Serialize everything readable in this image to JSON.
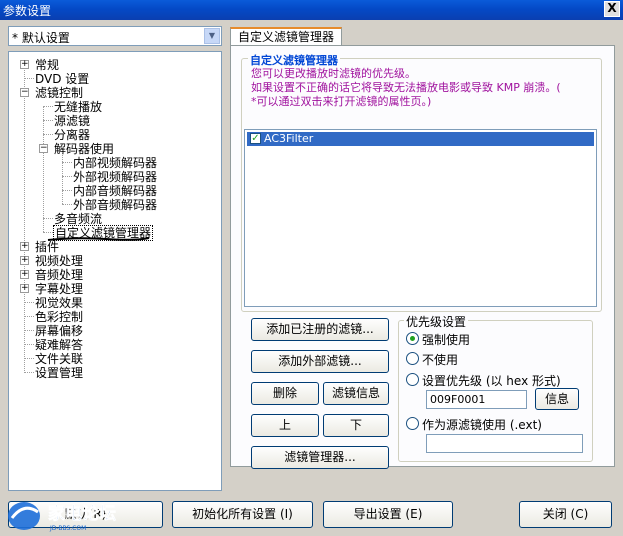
{
  "window": {
    "title": "参数设置",
    "close_label": "X"
  },
  "profile_select": {
    "value": "* 默认设置"
  },
  "tree": {
    "items": [
      {
        "label": "常规",
        "expander": "+"
      },
      {
        "label": "DVD 设置"
      },
      {
        "label": "滤镜控制",
        "expander": "−"
      },
      {
        "label": "无缝播放"
      },
      {
        "label": "源滤镜"
      },
      {
        "label": "分离器"
      },
      {
        "label": "解码器使用",
        "expander": "−"
      },
      {
        "label": "内部视频解码器"
      },
      {
        "label": "外部视频解码器"
      },
      {
        "label": "内部音频解码器"
      },
      {
        "label": "外部音频解码器"
      },
      {
        "label": "多音频流"
      },
      {
        "label": "自定义滤镜管理器",
        "selected": true
      },
      {
        "label": "插件",
        "expander": "+"
      },
      {
        "label": "视频处理",
        "expander": "+"
      },
      {
        "label": "音频处理",
        "expander": "+"
      },
      {
        "label": "字幕处理",
        "expander": "+"
      },
      {
        "label": "视觉效果"
      },
      {
        "label": "色彩控制"
      },
      {
        "label": "屏幕偏移"
      },
      {
        "label": "疑难解答"
      },
      {
        "label": "文件关联"
      },
      {
        "label": "设置管理"
      }
    ]
  },
  "tab": {
    "label": "自定义滤镜管理器"
  },
  "group_main": {
    "title": "自定义滤镜管理器",
    "info_lines": [
      "您可以更改播放时滤镜的优先级。",
      "如果设置不正确的话它将导致无法播放电影或导致 KMP 崩溃。(",
      "*可以通过双击来打开滤镜的属性页。)"
    ]
  },
  "filter_list": {
    "items": [
      {
        "label": "AC3Filter",
        "checked": true,
        "check_glyph": "✓"
      }
    ]
  },
  "buttons": {
    "add_registered": "添加已注册的滤镜...",
    "add_external": "添加外部滤镜...",
    "delete": "删除",
    "filter_info": "滤镜信息",
    "up": "上",
    "down": "下",
    "filter_manager": "滤镜管理器..."
  },
  "priority": {
    "title": "优先级设置",
    "force": "强制使用",
    "disable": "不使用",
    "set_priority": "设置优先级 (以 hex 形式)",
    "priority_value": "009F0001",
    "info_button": "信息",
    "as_source": "作为源滤镜使用 (.ext)",
    "source_ext_value": "",
    "selected": "force"
  },
  "bottom": {
    "default_label": "默认(R)",
    "init_all_label": "初始化所有设置 (I)",
    "export_label": "导出设置 (E)",
    "close_label": "关闭 (C)"
  },
  "watermark": {
    "text": "家电论坛",
    "sub": "JD-BBS.COM"
  },
  "colors": {
    "title_bar": "#0a5bd9",
    "selection": "#316ac5",
    "info_text": "#a0129e",
    "tab_accent": "#e68b2c"
  }
}
